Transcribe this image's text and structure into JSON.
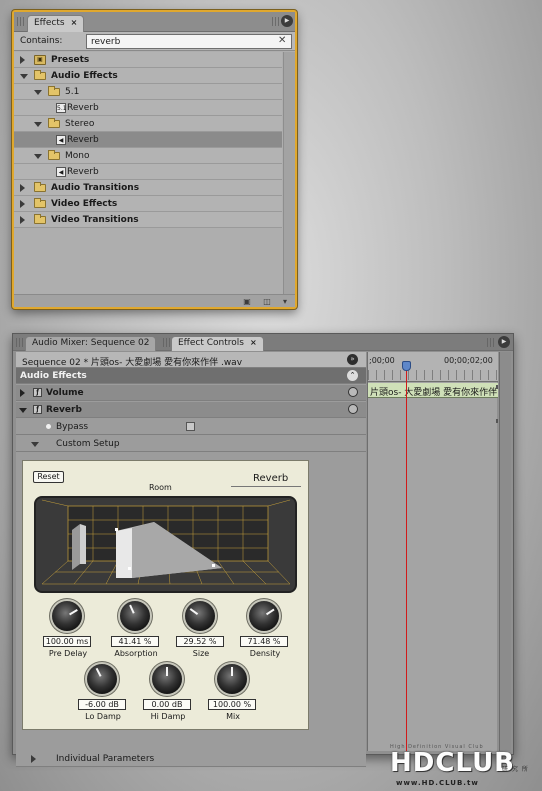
{
  "effects_panel": {
    "tab_label": "Effects",
    "tab_close": "×",
    "contains_label": "Contains:",
    "search_value": "reverb",
    "search_clear": "✕",
    "tree": [
      {
        "label": "Presets",
        "level": 0,
        "kind": "presets",
        "expanded": false,
        "bold": true
      },
      {
        "label": "Audio Effects",
        "level": 0,
        "kind": "folder",
        "expanded": true,
        "bold": true
      },
      {
        "label": "5.1",
        "level": 1,
        "kind": "folder",
        "expanded": true,
        "bold": false
      },
      {
        "label": "Reverb",
        "level": 2,
        "kind": "effect",
        "badge": "5.1",
        "bold": false
      },
      {
        "label": "Stereo",
        "level": 1,
        "kind": "folder",
        "expanded": true,
        "bold": false
      },
      {
        "label": "Reverb",
        "level": 2,
        "kind": "effect",
        "badge": "◀",
        "bold": false,
        "selected": true
      },
      {
        "label": "Mono",
        "level": 1,
        "kind": "folder",
        "expanded": true,
        "bold": false
      },
      {
        "label": "Reverb",
        "level": 2,
        "kind": "effect",
        "badge": "◀",
        "bold": false
      },
      {
        "label": "Audio Transitions",
        "level": 0,
        "kind": "folder",
        "expanded": false,
        "bold": true
      },
      {
        "label": "Video Effects",
        "level": 0,
        "kind": "folder",
        "expanded": false,
        "bold": true
      },
      {
        "label": "Video Transitions",
        "level": 0,
        "kind": "folder",
        "expanded": false,
        "bold": true
      }
    ]
  },
  "effect_controls_panel": {
    "tabs": [
      {
        "label": "Audio Mixer: Sequence 02",
        "active": false
      },
      {
        "label": "Effect Controls",
        "active": true,
        "close": "×"
      }
    ],
    "sequence_label": "Sequence 02 * 片頭os- 大愛劇場 愛有你來作伴 .wav",
    "section_label": "Audio Effects",
    "effects": [
      {
        "label": "Volume"
      },
      {
        "label": "Reverb"
      }
    ],
    "bypass_label": "Bypass",
    "custom_setup_label": "Custom Setup",
    "individual_params_label": "Individual Parameters",
    "timeline": {
      "start_tc": ";00;00",
      "end_tc": "00;00;02;00",
      "clip_label": "片頭os- 大愛劇場 愛有你來作伴"
    },
    "reverb_ui": {
      "reset_label": "Reset",
      "room_label": "Room",
      "title": "Reverb",
      "knobs": [
        {
          "label": "Pre Delay",
          "value": "100.00 ms",
          "level": 0.72
        },
        {
          "label": "Absorption",
          "value": "41.41 %",
          "level": 0.41
        },
        {
          "label": "Size",
          "value": "29.52 %",
          "level": 0.3
        },
        {
          "label": "Density",
          "value": "71.48 %",
          "level": 0.71
        },
        {
          "label": "Lo Damp",
          "value": "-6.00 dB",
          "level": 0.4
        },
        {
          "label": "Hi Damp",
          "value": "0.00 dB",
          "level": 0.5
        },
        {
          "label": "Mix",
          "value": "100.00 %",
          "level": 0.5
        }
      ]
    }
  },
  "watermark": {
    "small_text": "High Definition Visual Club",
    "main_text": "HDCLUB",
    "chinese_text": "研 究 所",
    "url": "www.HD.CLUB.tw"
  },
  "colors": {
    "panel_focus_border": "#e0a82e",
    "cti_line": "#d11a1a",
    "clip_bar": "#cfe0b8",
    "room_grid": "#c8a23a"
  }
}
